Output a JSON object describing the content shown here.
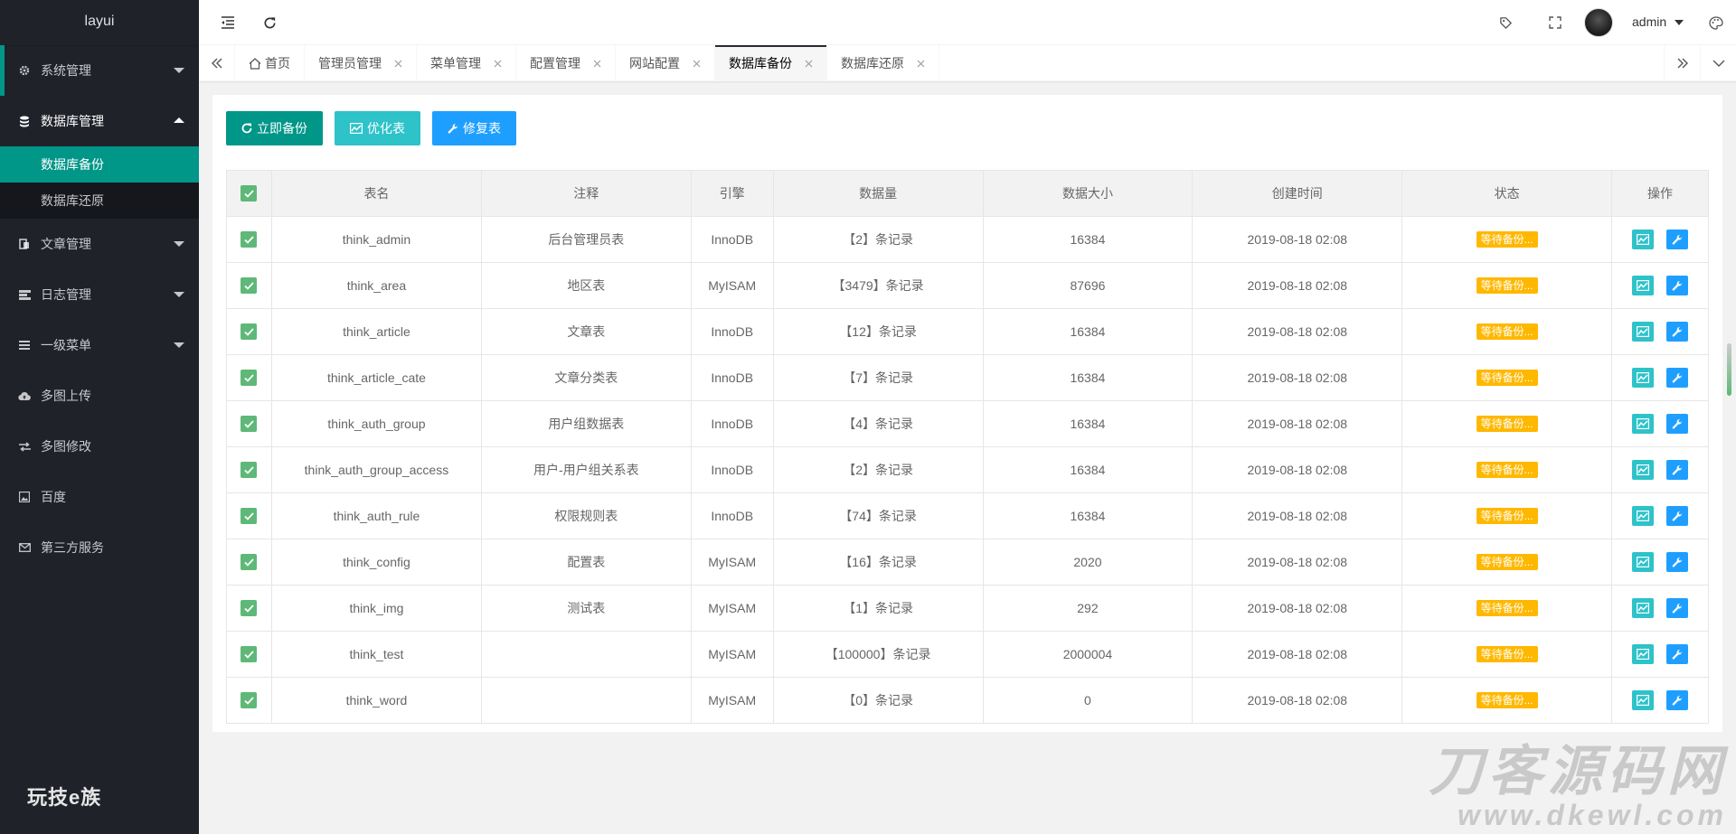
{
  "sidebar": {
    "logo": "layui",
    "brand": "玩技e族",
    "menu": [
      {
        "label": "系统管理",
        "icon": "gear-icon"
      },
      {
        "label": "数据库管理",
        "icon": "database-icon"
      },
      {
        "label": "文章管理",
        "icon": "document-icon"
      },
      {
        "label": "日志管理",
        "icon": "log-icon"
      },
      {
        "label": "一级菜单",
        "icon": "list-icon"
      },
      {
        "label": "多图上传",
        "icon": "cloud-upload-icon"
      },
      {
        "label": "多图修改",
        "icon": "swap-icon"
      },
      {
        "label": "百度",
        "icon": "picture-icon"
      },
      {
        "label": "第三方服务",
        "icon": "mail-icon"
      }
    ],
    "submenu": [
      {
        "label": "数据库备份"
      },
      {
        "label": "数据库还原"
      }
    ]
  },
  "header": {
    "username": "admin"
  },
  "tabs": [
    {
      "label": "首页"
    },
    {
      "label": "管理员管理"
    },
    {
      "label": "菜单管理"
    },
    {
      "label": "配置管理"
    },
    {
      "label": "网站配置"
    },
    {
      "label": "数据库备份"
    },
    {
      "label": "数据库还原"
    }
  ],
  "toolbar": {
    "backup": "立即备份",
    "optimize": "优化表",
    "repair": "修复表"
  },
  "table": {
    "columns": [
      "表名",
      "注释",
      "引擎",
      "数据量",
      "数据大小",
      "创建时间",
      "状态",
      "操作"
    ],
    "rows": [
      {
        "name": "think_admin",
        "comment": "后台管理员表",
        "engine": "InnoDB",
        "count": "【2】条记录",
        "size": "16384",
        "created": "2019-08-18 02:08",
        "status": "等待备份..."
      },
      {
        "name": "think_area",
        "comment": "地区表",
        "engine": "MyISAM",
        "count": "【3479】条记录",
        "size": "87696",
        "created": "2019-08-18 02:08",
        "status": "等待备份..."
      },
      {
        "name": "think_article",
        "comment": "文章表",
        "engine": "InnoDB",
        "count": "【12】条记录",
        "size": "16384",
        "created": "2019-08-18 02:08",
        "status": "等待备份..."
      },
      {
        "name": "think_article_cate",
        "comment": "文章分类表",
        "engine": "InnoDB",
        "count": "【7】条记录",
        "size": "16384",
        "created": "2019-08-18 02:08",
        "status": "等待备份..."
      },
      {
        "name": "think_auth_group",
        "comment": "用户组数据表",
        "engine": "InnoDB",
        "count": "【4】条记录",
        "size": "16384",
        "created": "2019-08-18 02:08",
        "status": "等待备份..."
      },
      {
        "name": "think_auth_group_access",
        "comment": "用户-用户组关系表",
        "engine": "InnoDB",
        "count": "【2】条记录",
        "size": "16384",
        "created": "2019-08-18 02:08",
        "status": "等待备份..."
      },
      {
        "name": "think_auth_rule",
        "comment": "权限规则表",
        "engine": "InnoDB",
        "count": "【74】条记录",
        "size": "16384",
        "created": "2019-08-18 02:08",
        "status": "等待备份..."
      },
      {
        "name": "think_config",
        "comment": "配置表",
        "engine": "MyISAM",
        "count": "【16】条记录",
        "size": "2020",
        "created": "2019-08-18 02:08",
        "status": "等待备份..."
      },
      {
        "name": "think_img",
        "comment": "测试表",
        "engine": "MyISAM",
        "count": "【1】条记录",
        "size": "292",
        "created": "2019-08-18 02:08",
        "status": "等待备份..."
      },
      {
        "name": "think_test",
        "comment": "",
        "engine": "MyISAM",
        "count": "【100000】条记录",
        "size": "2000004",
        "created": "2019-08-18 02:08",
        "status": "等待备份..."
      },
      {
        "name": "think_word",
        "comment": "",
        "engine": "MyISAM",
        "count": "【0】条记录",
        "size": "0",
        "created": "2019-08-18 02:08",
        "status": "等待备份..."
      }
    ]
  },
  "watermark": {
    "line1": "刀客源码网",
    "line2": "www.dkewl.com"
  },
  "colors": {
    "sidebar_bg": "#20222a",
    "accent": "#009688",
    "cyan": "#2ec2c9",
    "blue": "#1e9fff",
    "checkbox": "#5fb878",
    "badge": "#ffb800"
  }
}
